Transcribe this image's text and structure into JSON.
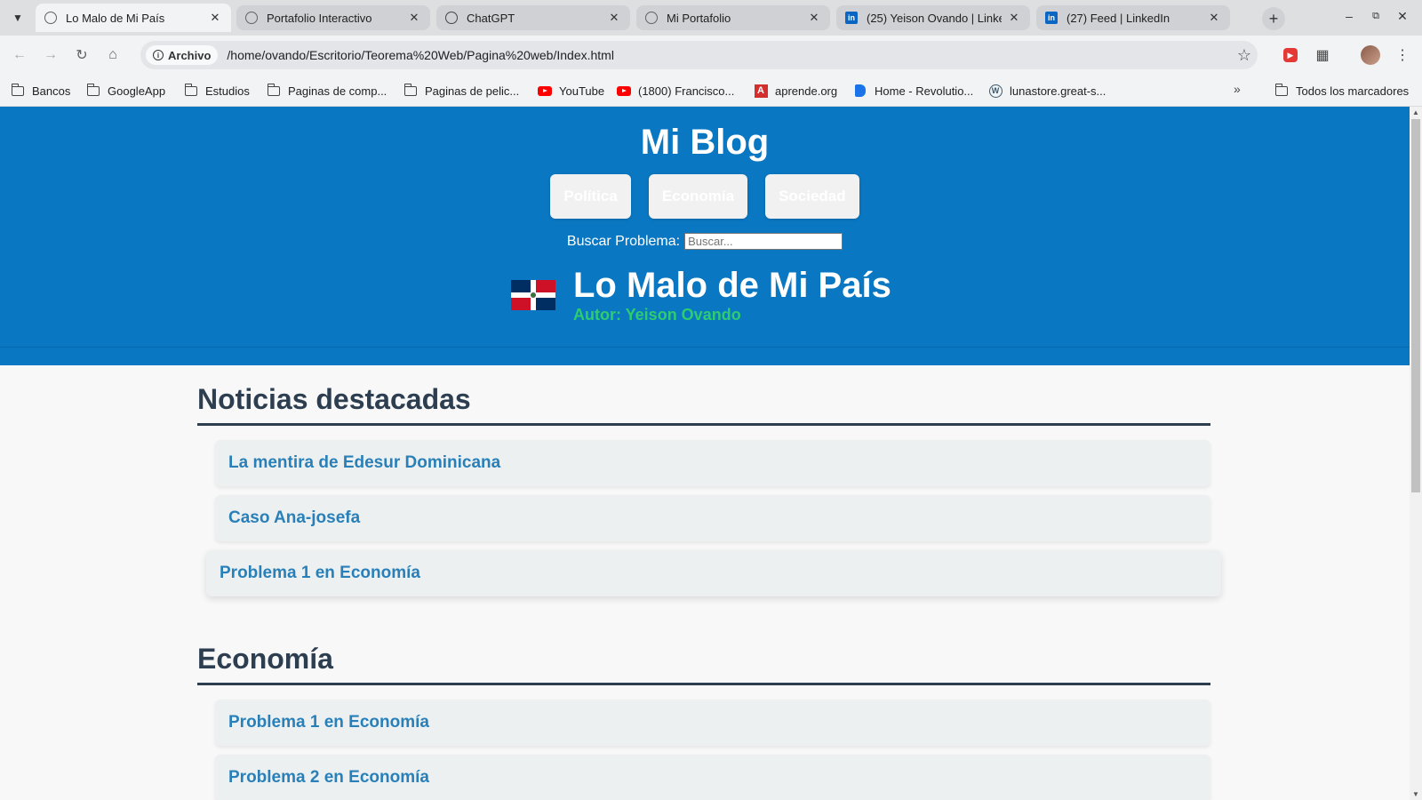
{
  "browser": {
    "tabs": [
      {
        "title": "Lo Malo de Mi País",
        "icon": "globe-icon",
        "active": true
      },
      {
        "title": "Portafolio Interactivo",
        "icon": "globe-icon",
        "active": false
      },
      {
        "title": "ChatGPT",
        "icon": "chatgpt-icon",
        "active": false
      },
      {
        "title": "Mi Portafolio",
        "icon": "globe-icon",
        "active": false
      },
      {
        "title": "(25) Yeison Ovando | LinkedIn",
        "icon": "linkedin-icon",
        "active": false
      },
      {
        "title": "(27) Feed | LinkedIn",
        "icon": "linkedin-icon",
        "active": false
      }
    ],
    "omnibox": {
      "chip": "Archivo",
      "url": "/home/ovando/Escritorio/Teorema%20Web/Pagina%20web/Index.html"
    },
    "bookmarks": [
      {
        "label": "Bancos",
        "icon": "folder-icon"
      },
      {
        "label": "GoogleApp",
        "icon": "folder-icon"
      },
      {
        "label": "Estudios",
        "icon": "folder-icon"
      },
      {
        "label": "Paginas de comp...",
        "icon": "folder-icon"
      },
      {
        "label": "Paginas de pelic...",
        "icon": "folder-icon"
      },
      {
        "label": "YouTube",
        "icon": "youtube-icon"
      },
      {
        "label": "(1800) Francisco...",
        "icon": "youtube-icon"
      },
      {
        "label": "aprende.org",
        "icon": "aprende-icon"
      },
      {
        "label": "Home - Revolutio...",
        "icon": "revolution-icon"
      },
      {
        "label": "lunastore.great-s...",
        "icon": "wordpress-icon"
      }
    ],
    "all_bookmarks": "Todos los marcadores"
  },
  "page": {
    "blog_title": "Mi Blog",
    "nav": [
      "Política",
      "Economía",
      "Sociedad"
    ],
    "search": {
      "label": "Buscar Problema:",
      "placeholder": "Buscar..."
    },
    "site_title": "Lo Malo de Mi País",
    "author": "Autor: Yeison Ovando",
    "sections": [
      {
        "heading": "Noticias destacadas",
        "items": [
          "La mentira de Edesur Dominicana",
          "Caso Ana-josefa",
          "Problema 1 en Economía"
        ]
      },
      {
        "heading": "Economía",
        "items": [
          "Problema 1 en Economía",
          "Problema 2 en Economía"
        ]
      }
    ]
  },
  "colors": {
    "header_bg": "#0a77c2",
    "heading": "#2c3e50",
    "link": "#2980b9",
    "author": "#2ecc71",
    "item_bg": "#ecf0f1"
  }
}
